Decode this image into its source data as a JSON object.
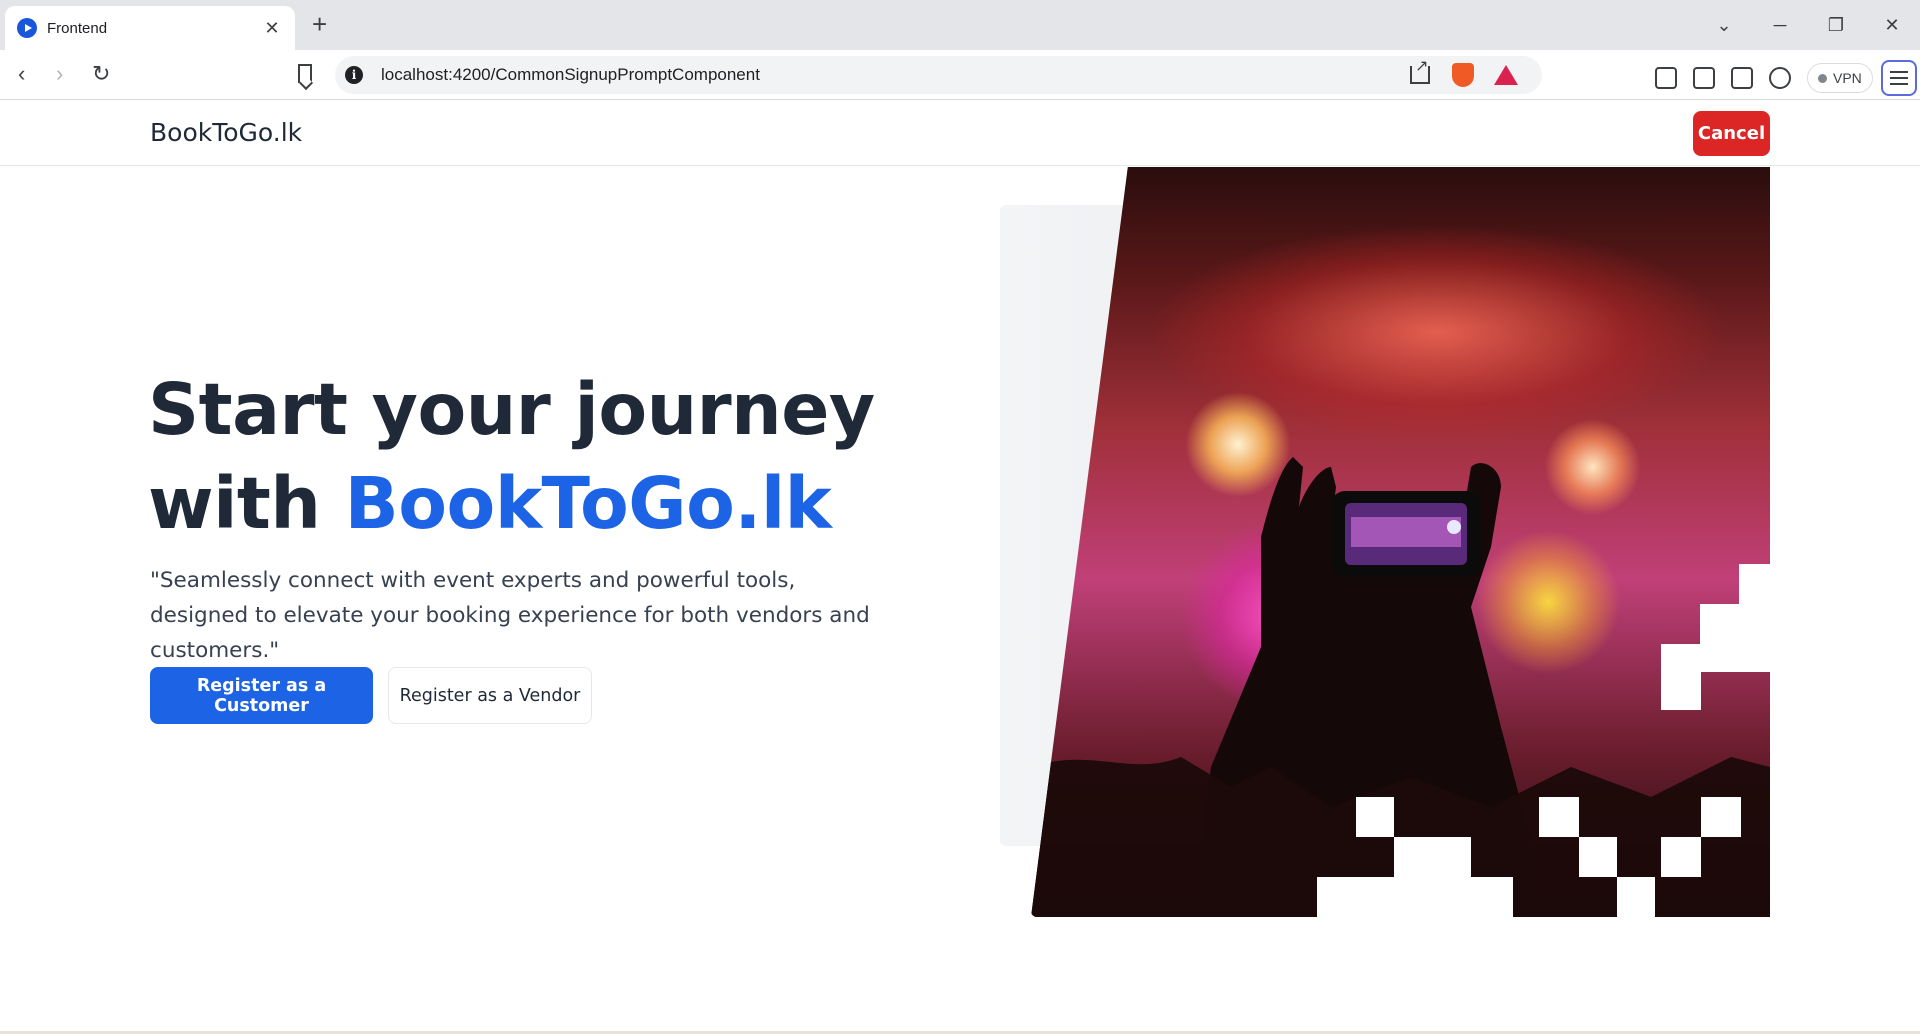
{
  "browser": {
    "tab_title": "Frontend",
    "url": "localhost:4200/CommonSignupPromptComponent",
    "vpn_label": "VPN"
  },
  "page": {
    "brand": "BookToGo.lk",
    "cancel_label": "Cancel",
    "hero": {
      "title_line1": "Start your journey",
      "title_with": "with ",
      "title_accent": "BookToGo.lk",
      "subtitle": "\"Seamlessly connect with event experts and powerful tools, designed to elevate your booking experience for both vendors and customers.\""
    },
    "buttons": {
      "customer": "Register as a Customer",
      "vendor": "Register as a Vendor"
    }
  },
  "colors": {
    "accent": "#1d63e6",
    "danger": "#dc2626",
    "text": "#1f2937"
  }
}
